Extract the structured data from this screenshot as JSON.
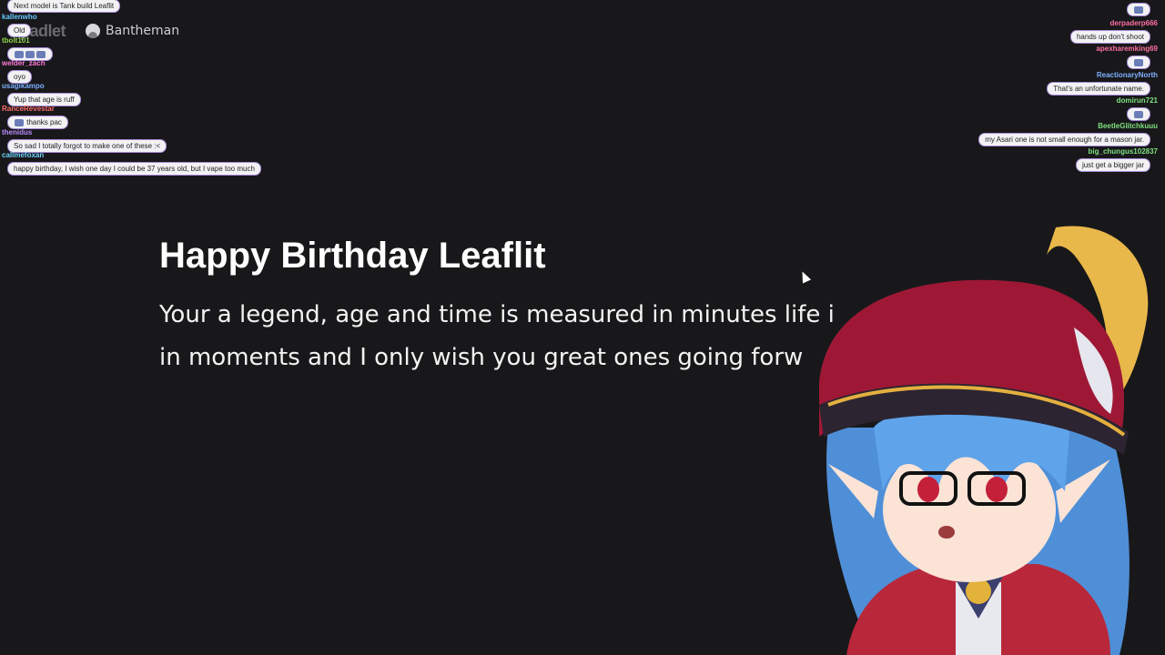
{
  "app": {
    "logo": "padlet",
    "user_name": "Bantheman"
  },
  "post": {
    "title": "Happy Birthday Leaflit",
    "body": "Your a legend, age and time is measured in minutes life i in moments and I only wish you great ones going forw"
  },
  "chat_left": [
    {
      "user": "",
      "text": "Next model is Tank build Leaflit",
      "user_color": "#c9a6ff"
    },
    {
      "user": "kallenwho",
      "text": "Old",
      "user_color": "#66c7ff"
    },
    {
      "user": "tbolt101",
      "text": "",
      "user_color": "#8fd44a"
    },
    {
      "user": "welder_zach",
      "text": "oyo",
      "user_color": "#ff7ad9"
    },
    {
      "user": "usagikampo",
      "text": "Yup that age is ruff",
      "user_color": "#7fb0ff"
    },
    {
      "user": "RanceRevestar",
      "text": "thanks pac",
      "user_color": "#ff6b6b"
    },
    {
      "user": "thenidus",
      "text": "So sad I totally forgot to make one of these :<",
      "user_color": "#b98bff"
    },
    {
      "user": "callmefoxan",
      "text": "happy birthday, I wish one day I could be 37 years old, but I vape too much",
      "user_color": "#6fd3ff"
    }
  ],
  "chat_right": [
    {
      "user": "",
      "text": "",
      "user_color": "#ff6fa0"
    },
    {
      "user": "derpaderp666",
      "text": "hands up don't shoot",
      "user_color": "#ff6fa0"
    },
    {
      "user": "apexharemking69",
      "text": "",
      "user_color": "#ff6fa0"
    },
    {
      "user": "ReactionaryNorth",
      "text": "That's an unfortunate name.",
      "user_color": "#7fb0ff"
    },
    {
      "user": "domirun721",
      "text": "",
      "user_color": "#7fe07f"
    },
    {
      "user": "BeetleGlitchkuuu",
      "text": "my Asari one is not small enough for a mason jar.",
      "user_color": "#7fe07f"
    },
    {
      "user": "big_chungus102837",
      "text": "just get a bigger jar",
      "user_color": "#7fe07f"
    }
  ]
}
